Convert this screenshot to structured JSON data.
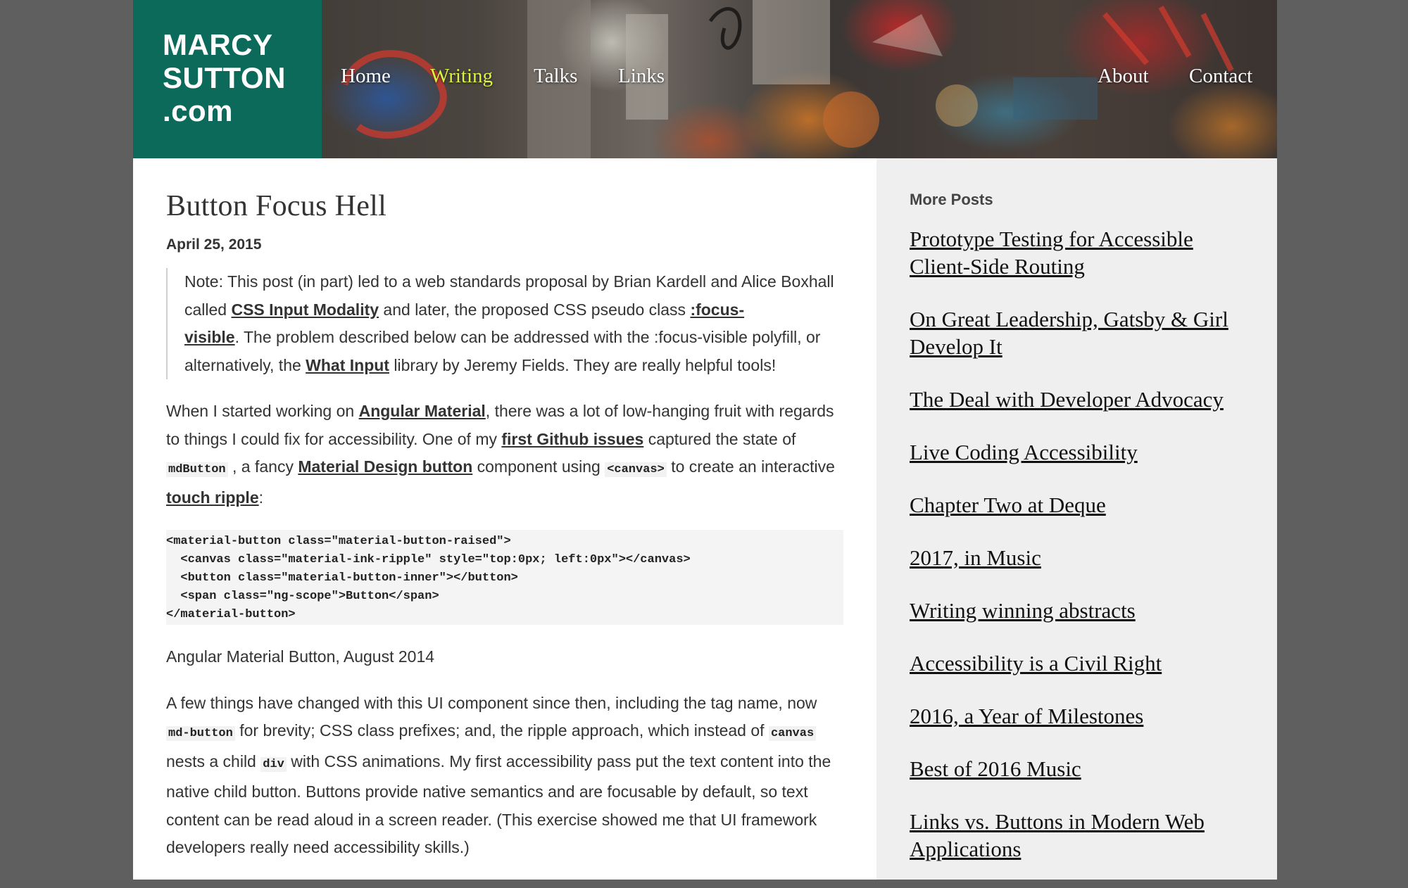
{
  "site": {
    "logo_lines": [
      "MARCY",
      "SUTTON",
      ".com"
    ]
  },
  "nav": {
    "items": [
      {
        "label": "Home",
        "active": false
      },
      {
        "label": "Writing",
        "active": true
      },
      {
        "label": "Talks",
        "active": false
      },
      {
        "label": "Links",
        "active": false
      },
      {
        "label": "About",
        "active": false
      },
      {
        "label": "Contact",
        "active": false
      }
    ],
    "active_color": "#d9f542"
  },
  "post": {
    "title": "Button Focus Hell",
    "date": "April 25, 2015",
    "note": {
      "t1": "Note: This post (in part) led to a web standards proposal by Brian Kardell and Alice Boxhall called ",
      "link1": "CSS Input Modality",
      "t2": " and later, the proposed CSS pseudo class ",
      "link2a": ":focus-",
      "link2b": "visible",
      "t3": ". The problem described below can be addressed with the :focus-visible polyfill, or alternatively, the ",
      "link3": "What Input",
      "t4": " library by Jeremy Fields. They are really helpful tools!"
    },
    "para1": {
      "t1": "When I started working on ",
      "link1": "Angular Material",
      "t2": ", there was a lot of low-hanging fruit with regards to things I could fix for accessibility. One of my ",
      "link2": "first Github issues",
      "t3": " captured the state of ",
      "code1": "mdButton",
      "t4": " , a fancy ",
      "link3": "Material Design button",
      "t5": " component using ",
      "code2": "<canvas>",
      "t6": " to create an interactive ",
      "link4": "touch ripple",
      "t7": ":"
    },
    "code_lines": [
      "<material-button class=\"material-button-raised\">",
      "  <canvas class=\"material-ink-ripple\" style=\"top:0px; left:0px\"></canvas>",
      "  <button class=\"material-button-inner\"></button>",
      "  <span class=\"ng-scope\">Button</span>",
      "</material-button>"
    ],
    "caption": "Angular Material Button, August 2014",
    "para2": {
      "t1": "A few things have changed with this UI component since then, including the tag name, now ",
      "code1": "md-button",
      "t2": " for brevity; CSS class prefixes; and, the ripple approach, which instead of ",
      "code2": "canvas",
      "t3": " nests a child ",
      "code3": "div",
      "t4": " with CSS animations. My first accessibility pass put the text content into the native child button. Buttons provide native semantics and are focusable by default, so text content can be read aloud in a screen reader. (This exercise showed me that UI framework developers really need accessibility skills.)"
    }
  },
  "sidebar": {
    "title": "More Posts",
    "posts": [
      "Prototype Testing for Accessible Client-Side Routing",
      "On Great Leadership, Gatsby & Girl Develop It",
      "The Deal with Developer Advocacy",
      "Live Coding Accessibility",
      "Chapter Two at Deque",
      "2017, in Music",
      "Writing winning abstracts",
      "Accessibility is a Civil Right",
      "2016, a Year of Milestones",
      "Best of 2016 Music",
      "Links vs. Buttons in Modern Web Applications"
    ]
  }
}
